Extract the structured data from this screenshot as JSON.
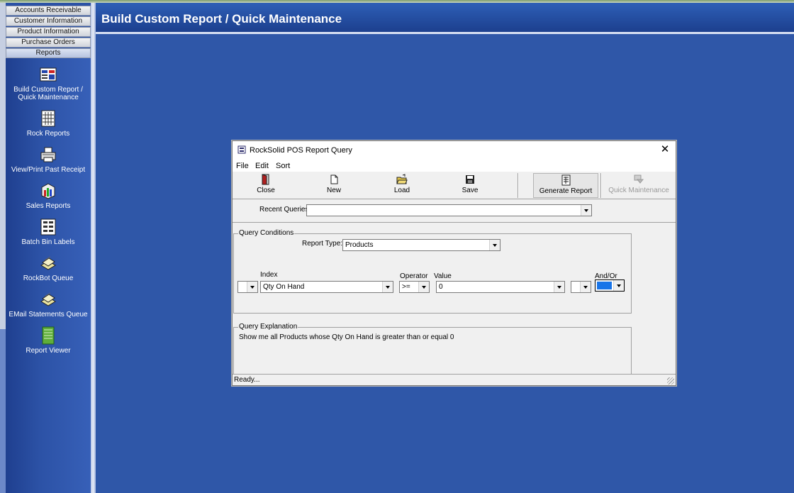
{
  "nav": {
    "buttons": [
      "Accounts Receivable",
      "Customer Information",
      "Product Information",
      "Purchase Orders",
      "Reports"
    ],
    "items": [
      {
        "label_line1": "Build Custom Report /",
        "label_line2": "Quick Maintenance",
        "icon": "report-builder-icon"
      },
      {
        "label_line1": "Rock Reports",
        "label_line2": "",
        "icon": "reports-list-icon"
      },
      {
        "label_line1": "View/Print Past Receipt",
        "label_line2": "",
        "icon": "printer-icon"
      },
      {
        "label_line1": "Sales Reports",
        "label_line2": "",
        "icon": "sales-chart-icon"
      },
      {
        "label_line1": "Batch Bin Labels",
        "label_line2": "",
        "icon": "labels-icon"
      },
      {
        "label_line1": "RockBot Queue",
        "label_line2": "",
        "icon": "queue-icon"
      },
      {
        "label_line1": "EMail Statements Queue",
        "label_line2": "",
        "icon": "email-queue-icon"
      },
      {
        "label_line1": "Report Viewer",
        "label_line2": "",
        "icon": "report-viewer-icon"
      }
    ]
  },
  "header": {
    "title": "Build Custom Report / Quick Maintenance"
  },
  "dialog": {
    "title": "RockSolid POS Report Query",
    "close_glyph": "✕",
    "menu": [
      "File",
      "Edit",
      "Sort"
    ],
    "toolbar": {
      "close": "Close",
      "new": "New",
      "load": "Load",
      "save": "Save",
      "generate": "Generate Report",
      "quick_maintenance": "Quick Maintenance"
    },
    "recent_queries_label": "Recent Queries:",
    "recent_queries_value": "",
    "query_conditions": {
      "group_label": "Query Conditions",
      "report_type_label": "Report Type:",
      "report_type_value": "Products",
      "index_label": "Index",
      "operator_label": "Operator",
      "value_label": "Value",
      "andor_label": "And/Or",
      "paren_open_value": "",
      "index_value": "Qty On Hand",
      "operator_value": ">=",
      "value_value": "0",
      "paren_close_value": "",
      "andor_value": ""
    },
    "query_explanation": {
      "group_label": "Query Explanation",
      "text": "Show me all Products whose  Qty On Hand is greater than or equal 0"
    },
    "status": "Ready..."
  },
  "colors": {
    "background": "#2f57a8",
    "header": "#1c3f8e",
    "dialog": "#f0f0f0",
    "andor_selection": "#1874e8"
  }
}
